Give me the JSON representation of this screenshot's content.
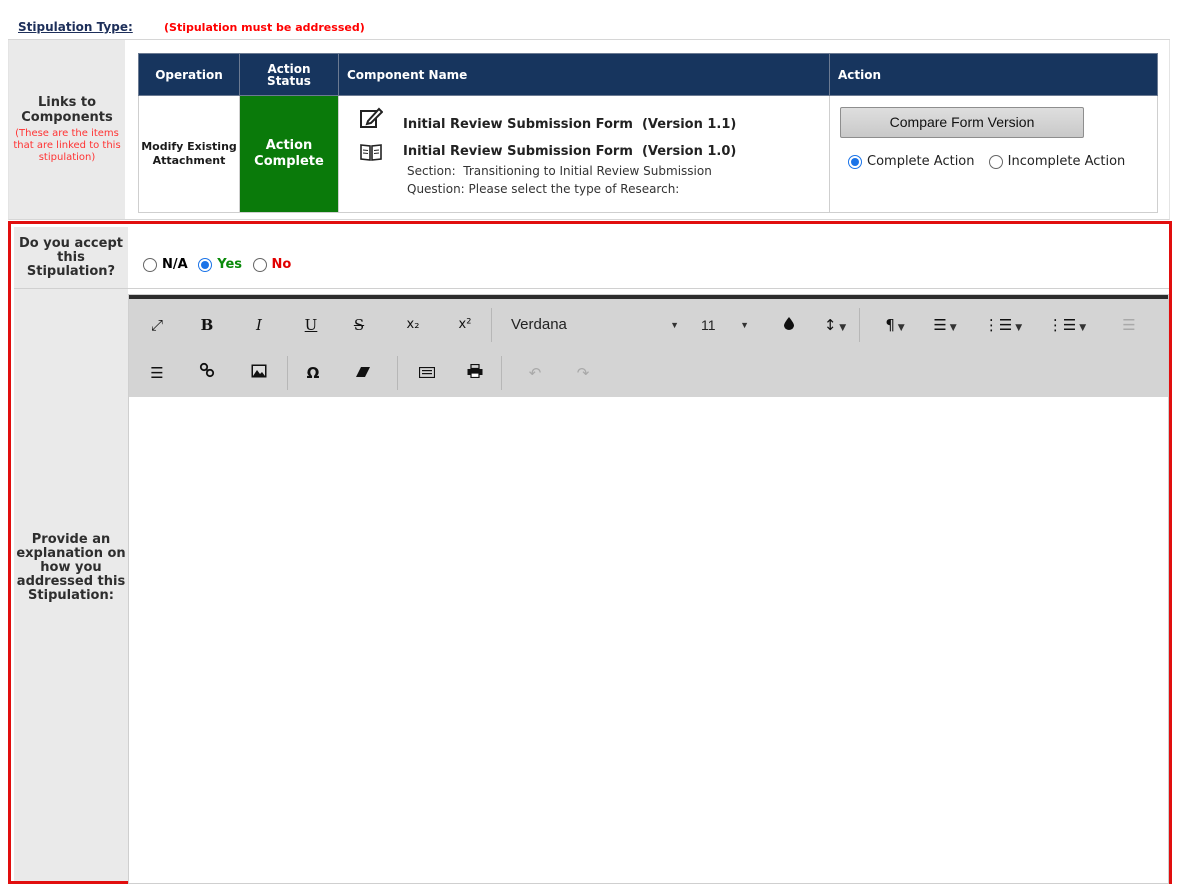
{
  "header": {
    "label": "Stipulation Type:",
    "note": "(Stipulation must be addressed)"
  },
  "links": {
    "title": "Links to Components",
    "note": "(These are the items that are linked to this stipulation)"
  },
  "table": {
    "headers": [
      "Operation",
      "Action Status",
      "Component Name",
      "Action"
    ],
    "row": {
      "operation": "Modify Existing Attachment",
      "status": "Action Complete",
      "components": [
        {
          "icon": "edit-document-icon",
          "name": "Initial Review Submission Form  (Version 1.1)"
        },
        {
          "icon": "open-book-icon",
          "name": "Initial Review Submission Form  (Version 1.0)"
        }
      ],
      "section": "Section:  Transitioning to Initial Review Submission",
      "question": "Question: Please select the type of Research:",
      "compare_button": "Compare Form Version",
      "radio_complete": "Complete Action",
      "radio_incomplete": "Incomplete Action",
      "selected_action": "Complete Action"
    }
  },
  "accept": {
    "label": "Do you accept this Stipulation?",
    "options": [
      "N/A",
      "Yes",
      "No"
    ],
    "selected": "Yes"
  },
  "explain": {
    "label": "Provide an explanation on how you addressed this Stipulation:"
  },
  "editor": {
    "font": "Verdana",
    "size": "11",
    "toolbar_row1": [
      "fullscreen-icon",
      "bold-icon",
      "italic-icon",
      "underline-icon",
      "strikethrough-icon",
      "subscript-icon",
      "superscript-icon",
      "font-family-select",
      "font-size-select",
      "text-color-icon",
      "line-height-icon",
      "paragraph-format-icon",
      "align-icon",
      "ordered-list-icon",
      "unordered-list-icon",
      "outdent-icon"
    ],
    "toolbar_row2": [
      "indent-icon",
      "link-icon",
      "image-icon",
      "special-chars-icon",
      "clear-format-icon",
      "keyboard-icon",
      "print-icon",
      "undo-icon",
      "redo-icon"
    ],
    "glyphs": {
      "bold": "B",
      "italic": "I",
      "underline": "U",
      "strike": "S",
      "sub": "x₂",
      "sup": "x²",
      "omega": "Ω",
      "paragraph": "¶",
      "height": "↕"
    }
  }
}
